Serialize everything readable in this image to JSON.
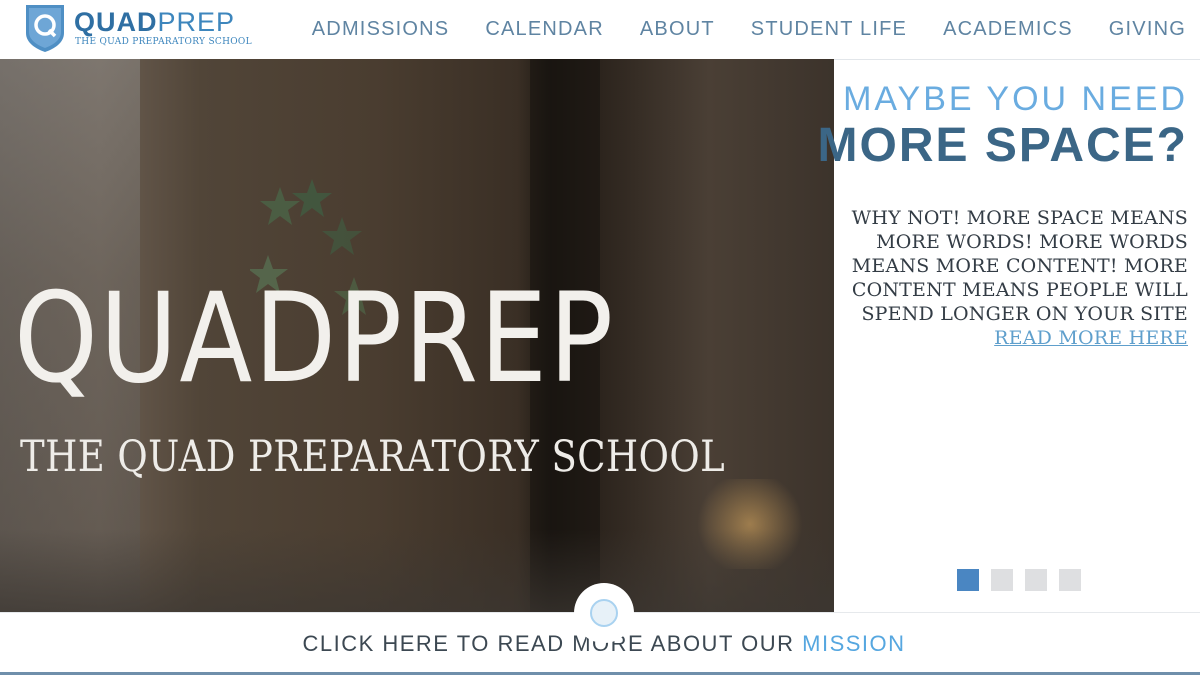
{
  "header": {
    "logo_name_bold": "QUAD",
    "logo_name_rest": "PREP",
    "logo_subtitle": "THE QUAD PREPARATORY SCHOOL",
    "logo_icon": "shield-q-icon",
    "nav": [
      {
        "label": "ADMISSIONS"
      },
      {
        "label": "CALENDAR"
      },
      {
        "label": "ABOUT"
      },
      {
        "label": "STUDENT LIFE"
      },
      {
        "label": "ACADEMICS"
      },
      {
        "label": "GIVING"
      }
    ]
  },
  "hero": {
    "title": "QUADPREP",
    "subtitle": "THE QUAD PREPARATORY SCHOOL"
  },
  "panel": {
    "eyebrow": "MAYBE YOU NEED",
    "headline": "MORE SPACE?",
    "body": "WHY NOT! MORE SPACE MEANS MORE WORDS! MORE WORDS MEANS MORE CONTENT! MORE CONTENT MEANS PEOPLE WILL SPEND LONGER ON YOUR SITE",
    "link": "READ MORE HERE",
    "slides_total": 4,
    "active_slide": 1
  },
  "bottom": {
    "mission_text": "CLICK HERE TO READ MORE ABOUT OUR",
    "mission_accent": "MISSION"
  },
  "colors": {
    "accent": "#56a7e0",
    "brand": "#3d86bd",
    "headline": "#3b6686",
    "active_dot": "#4a86c2"
  }
}
